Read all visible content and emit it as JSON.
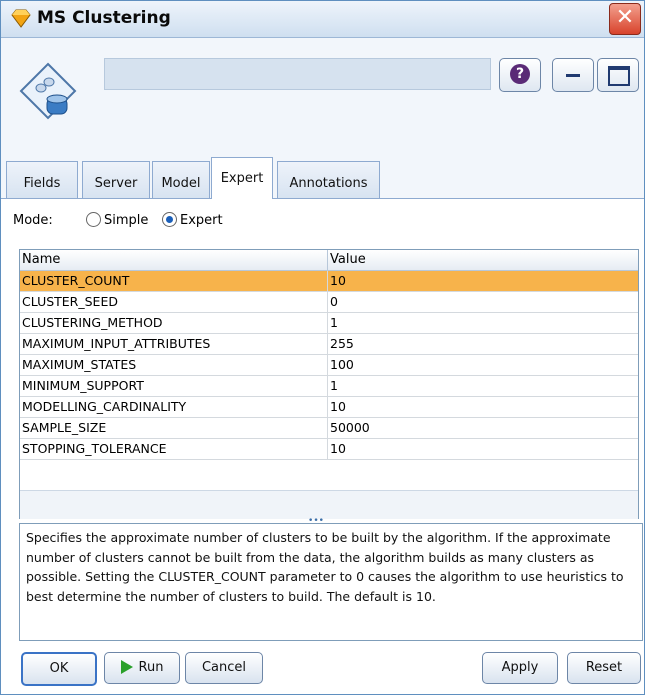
{
  "window": {
    "title": "MS Clustering"
  },
  "header": {
    "name_value": "",
    "help_label": "?"
  },
  "tabs": [
    {
      "label": "Fields"
    },
    {
      "label": "Server"
    },
    {
      "label": "Model"
    },
    {
      "label": "Expert",
      "active": true
    },
    {
      "label": "Annotations"
    }
  ],
  "mode": {
    "label": "Mode:",
    "options": [
      "Simple",
      "Expert"
    ],
    "selected": "Expert"
  },
  "table": {
    "columns": [
      "Name",
      "Value"
    ],
    "rows": [
      {
        "name": "CLUSTER_COUNT",
        "value": "10",
        "selected": true
      },
      {
        "name": "CLUSTER_SEED",
        "value": "0"
      },
      {
        "name": "CLUSTERING_METHOD",
        "value": "1"
      },
      {
        "name": "MAXIMUM_INPUT_ATTRIBUTES",
        "value": "255"
      },
      {
        "name": "MAXIMUM_STATES",
        "value": "100"
      },
      {
        "name": "MINIMUM_SUPPORT",
        "value": "1"
      },
      {
        "name": "MODELLING_CARDINALITY",
        "value": "10"
      },
      {
        "name": "SAMPLE_SIZE",
        "value": "50000"
      },
      {
        "name": "STOPPING_TOLERANCE",
        "value": "10"
      }
    ]
  },
  "description": "Specifies the approximate number of clusters to be built by the algorithm. If the approximate number of clusters cannot be built from the data, the algorithm builds as many clusters as possible. Setting the CLUSTER_COUNT parameter to 0 causes the algorithm to use heuristics to best determine the number of clusters to build.     The default is 10.",
  "buttons": {
    "ok": "OK",
    "run": "Run",
    "cancel": "Cancel",
    "apply": "Apply",
    "reset": "Reset"
  },
  "colors": {
    "selected_row": "#f7b34b",
    "accent": "#3a73c6"
  }
}
